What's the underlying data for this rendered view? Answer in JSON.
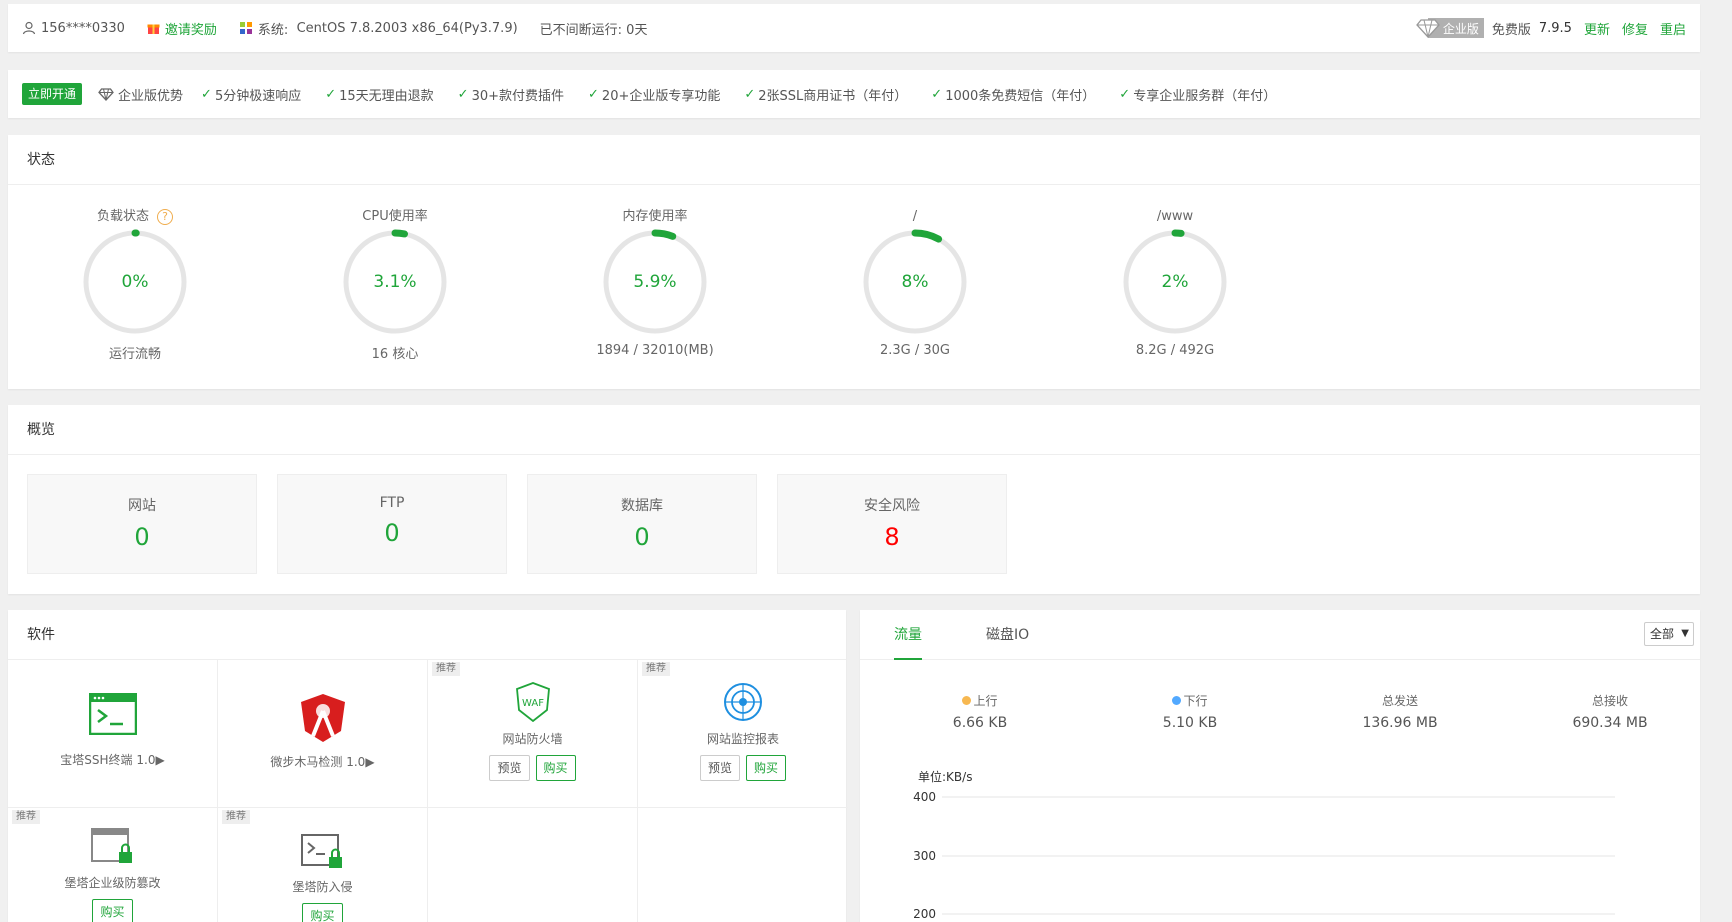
{
  "topbar": {
    "user": "156****0330",
    "invite": "邀请奖励",
    "system_label": "系统:",
    "system_value": "CentOS 7.8.2003 x86_64(Py3.7.9)",
    "uptime": "已不间断运行: 0天",
    "enterprise_badge": "企业版",
    "edition": "免费版",
    "version": "7.9.5",
    "update": "更新",
    "repair": "修复",
    "restart": "重启"
  },
  "enterprise_bar": {
    "open_button": "立即开通",
    "advantage": "企业版优势",
    "features": [
      "5分钟极速响应",
      "15天无理由退款",
      "30+款付费插件",
      "20+企业版专享功能",
      "2张SSL商用证书（年付）",
      "1000条免费短信（年付）",
      "专享企业服务群（年付）"
    ]
  },
  "status": {
    "title": "状态",
    "gauges": [
      {
        "title": "负载状态",
        "value": "0%",
        "sub": "运行流畅",
        "fraction": 0.0,
        "help": "?"
      },
      {
        "title": "CPU使用率",
        "value": "3.1%",
        "sub": "16 核心",
        "fraction": 0.031
      },
      {
        "title": "内存使用率",
        "value": "5.9%",
        "sub": "1894 / 32010(MB)",
        "fraction": 0.059
      },
      {
        "title": "/",
        "value": "8%",
        "sub": "2.3G / 30G",
        "fraction": 0.08
      },
      {
        "title": "/www",
        "value": "2%",
        "sub": "8.2G / 492G",
        "fraction": 0.02
      }
    ]
  },
  "overview": {
    "title": "概览",
    "cards": [
      {
        "label": "网站",
        "value": "0"
      },
      {
        "label": "FTP",
        "value": "0"
      },
      {
        "label": "数据库",
        "value": "0"
      },
      {
        "label": "安全风险",
        "value": "8"
      }
    ]
  },
  "software": {
    "title": "软件",
    "recommend_tag": "推荐",
    "preview": "预览",
    "buy": "购买",
    "items": [
      {
        "name": "宝塔SSH终端 1.0▶"
      },
      {
        "name": "微步木马检测 1.0▶"
      },
      {
        "name": "网站防火墙"
      },
      {
        "name": "网站监控报表"
      },
      {
        "name": "堡塔企业级防篡改"
      },
      {
        "name": "堡塔防入侵"
      }
    ],
    "waf_text": "WAF"
  },
  "traffic": {
    "tabs": [
      "流量",
      "磁盘IO"
    ],
    "select_value": "全部",
    "stats": [
      {
        "label": "上行",
        "value": "6.66 KB",
        "color": "#f7b851"
      },
      {
        "label": "下行",
        "value": "5.10 KB",
        "color": "#52a9ff"
      },
      {
        "label": "总发送",
        "value": "136.96 MB"
      },
      {
        "label": "总接收",
        "value": "690.34 MB"
      }
    ],
    "unit": "单位:KB/s",
    "y_ticks": [
      "400",
      "300",
      "200"
    ]
  },
  "colors": {
    "accent": "#20a53a",
    "danger": "#ff0000"
  }
}
